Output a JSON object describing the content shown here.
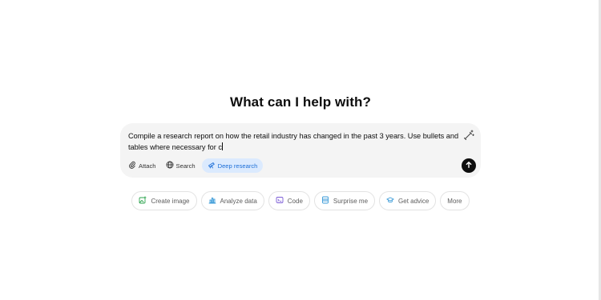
{
  "heading": "What can I help with?",
  "composer": {
    "prompt_text": "Compile a research report on how the retail industry has changed in the past 3 years. Use bullets and tables where necessary for c",
    "tools": [
      {
        "label": "Attach",
        "icon": "paperclip-icon"
      },
      {
        "label": "Search",
        "icon": "globe-icon"
      },
      {
        "label": "Deep research",
        "icon": "telescope-icon",
        "active": true
      }
    ]
  },
  "suggestions": [
    {
      "label": "Create image",
      "icon": "image-icon",
      "color": "#2ea44f"
    },
    {
      "label": "Analyze data",
      "icon": "bar-chart-icon",
      "color": "#3b9bd8"
    },
    {
      "label": "Code",
      "icon": "code-icon",
      "color": "#7c5cd6"
    },
    {
      "label": "Surprise me",
      "icon": "gift-icon",
      "color": "#3b9bd8"
    },
    {
      "label": "Get advice",
      "icon": "graduation-cap-icon",
      "color": "#3b9bd8"
    },
    {
      "label": "More"
    }
  ],
  "colors": {
    "accent_blue": "#1d6fd8",
    "active_pill_bg": "#dbeafe",
    "composer_bg": "#f4f4f4",
    "send_button": "#0d0d0d"
  }
}
